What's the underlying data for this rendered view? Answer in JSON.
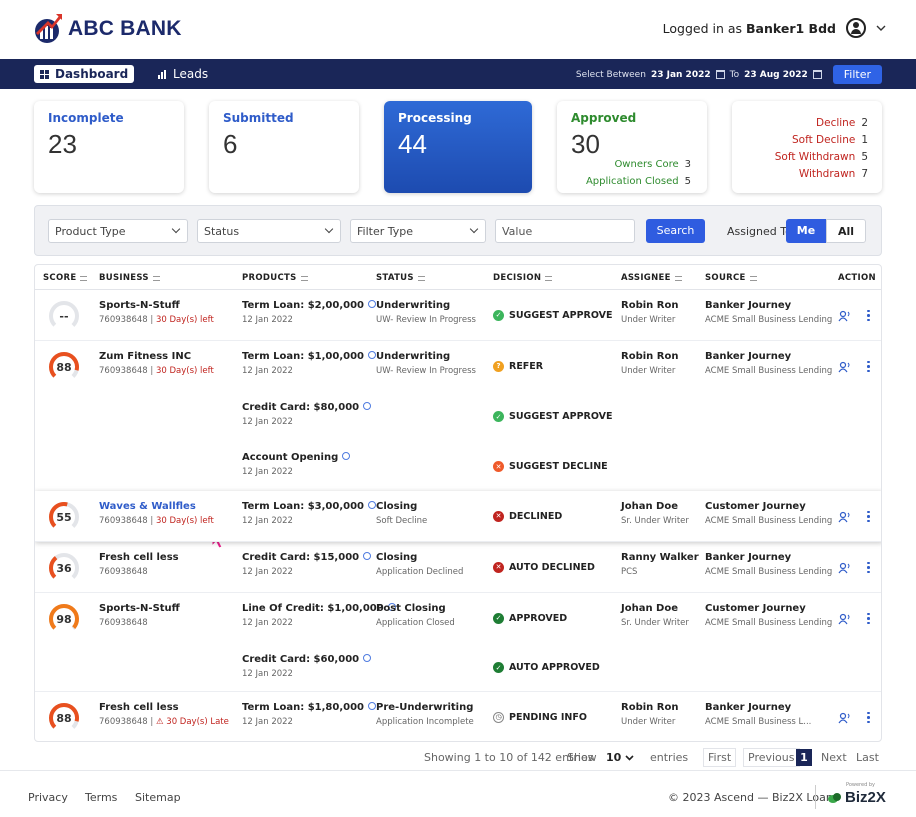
{
  "brand": {
    "name": "ABC BANK"
  },
  "header": {
    "logged_prefix": "Logged in as",
    "user": "Banker1 Bdd"
  },
  "nav": {
    "tabs": [
      {
        "label": "Dashboard",
        "icon": "grid-icon"
      },
      {
        "label": "Leads",
        "icon": "bar-chart-icon"
      }
    ],
    "range_label": "Select Between",
    "from": "23 Jan 2022",
    "to_label": "To",
    "to": "23 Aug 2022",
    "filter": "Filter"
  },
  "cards": {
    "incomplete": {
      "label": "Incomplete",
      "value": "23"
    },
    "submitted": {
      "label": "Submitted",
      "value": "6"
    },
    "processing": {
      "label": "Processing",
      "value": "44"
    },
    "approved": {
      "label": "Approved",
      "value": "30",
      "lines": [
        {
          "label": "Owners Core",
          "value": "3"
        },
        {
          "label": "Application Closed",
          "value": "5"
        }
      ]
    },
    "other": [
      {
        "label": "Decline",
        "value": "2"
      },
      {
        "label": "Soft Decline",
        "value": "1"
      },
      {
        "label": "Soft Withdrawn",
        "value": "5"
      },
      {
        "label": "Withdrawn",
        "value": "7"
      }
    ]
  },
  "filters": {
    "product_type": "Product Type",
    "status": "Status",
    "filter_type": "Filter Type",
    "value_placeholder": "Value",
    "search": "Search",
    "assigned_label": "Assigned To",
    "me": "Me",
    "all": "All"
  },
  "table": {
    "headers": [
      "SCORE",
      "BUSINESS",
      "PRODUCTS",
      "STATUS",
      "DECISION",
      "ASSIGNEE",
      "SOURCE",
      "ACTION"
    ],
    "rows": [
      {
        "score": "--",
        "score_pct": 0,
        "biz": "Sports-N-Stuff",
        "id": "760938648",
        "days": "30 Day(s) left",
        "product": "Term Loan: $2,00,000",
        "pdate": "12 Jan 2022",
        "status": "Underwriting",
        "status2": "UW- Review In Progress",
        "decision": "SUGGEST APPROVE",
        "assignee": "Robin Ron",
        "role": "Under Writer",
        "source": "Banker Journey",
        "source2": "ACME Small Business Lending"
      },
      {
        "score": "88",
        "score_pct": 88,
        "biz": "Zum Fitness INC",
        "id": "760938648",
        "days": "30 Day(s) left",
        "product": "Term Loan: $1,00,000",
        "pdate": "12 Jan 2022",
        "status": "Underwriting",
        "status2": "UW- Review In Progress",
        "decision": "REFER",
        "assignee": "Robin Ron",
        "role": "Under Writer",
        "source": "Banker Journey",
        "source2": "ACME Small Business Lending"
      },
      {
        "product": "Credit Card: $80,000",
        "pdate": "12 Jan 2022",
        "decision": "SUGGEST APPROVE"
      },
      {
        "product": "Account Opening",
        "pdate": "12 Jan 2022",
        "decision": "SUGGEST DECLINE"
      },
      {
        "score": "55",
        "score_pct": 55,
        "biz": "Waves & Wallfles",
        "id": "760938648",
        "days": "30 Day(s) left",
        "product": "Term Loan: $3,00,000",
        "pdate": "12 Jan 2022",
        "status": "Closing",
        "status2": "Soft Decline",
        "decision": "DECLINED",
        "assignee": "Johan Doe",
        "role": "Sr. Under Writer",
        "source": "Customer Journey",
        "source2": "ACME Small Business Lending"
      },
      {
        "score": "36",
        "score_pct": 36,
        "biz": "Fresh cell less",
        "id": "760938648",
        "product": "Credit Card: $15,000",
        "pdate": "12 Jan 2022",
        "status": "Closing",
        "status2": "Application Declined",
        "decision": "AUTO DECLINED",
        "assignee": "Ranny Walker",
        "role": "PCS",
        "source": "Banker Journey",
        "source2": "ACME Small Business Lending"
      },
      {
        "score": "98",
        "score_pct": 98,
        "biz": "Sports-N-Stuff",
        "id": "760938648",
        "product": "Line Of Credit: $1,00,000",
        "pdate": "12 Jan 2022",
        "status": "Post Closing",
        "status2": "Application Closed",
        "decision": "APPROVED",
        "assignee": "Johan Doe",
        "role": "Sr. Under Writer",
        "source": "Customer Journey",
        "source2": "ACME Small Business Lending"
      },
      {
        "product": "Credit Card: $60,000",
        "pdate": "12 Jan 2022",
        "decision": "AUTO APPROVED"
      },
      {
        "score": "88",
        "score_pct": 88,
        "biz": "Fresh cell less",
        "id": "760938648 |",
        "days": "30 Day(s) Late",
        "product": "Term Loan: $1,80,000",
        "pdate": "12 Jan 2022",
        "status": "Pre-Underwriting",
        "status2": "Application Incomplete",
        "decision": "PENDING INFO",
        "assignee": "Robin Ron",
        "role": "Under Writer",
        "source": "Banker Journey",
        "source2": "ACME Small Business L..."
      }
    ]
  },
  "pager": {
    "showing": "Showing 1 to 10 of 142 entries",
    "show": "Show",
    "size": "10",
    "entries": "entries",
    "first": "First",
    "previous": "Previous",
    "page": "1",
    "next": "Next",
    "last": "Last"
  },
  "footer": {
    "privacy": "Privacy",
    "terms": "Terms",
    "sitemap": "Sitemap",
    "copyright": "© 2023 Ascend — Biz2X Loans",
    "powered": "Powered by",
    "partner": "Biz2X"
  },
  "colors": {
    "navy": "#1a2658",
    "blue": "#2f5ce0",
    "green": "#2e8b2e",
    "red": "#c0241f"
  }
}
